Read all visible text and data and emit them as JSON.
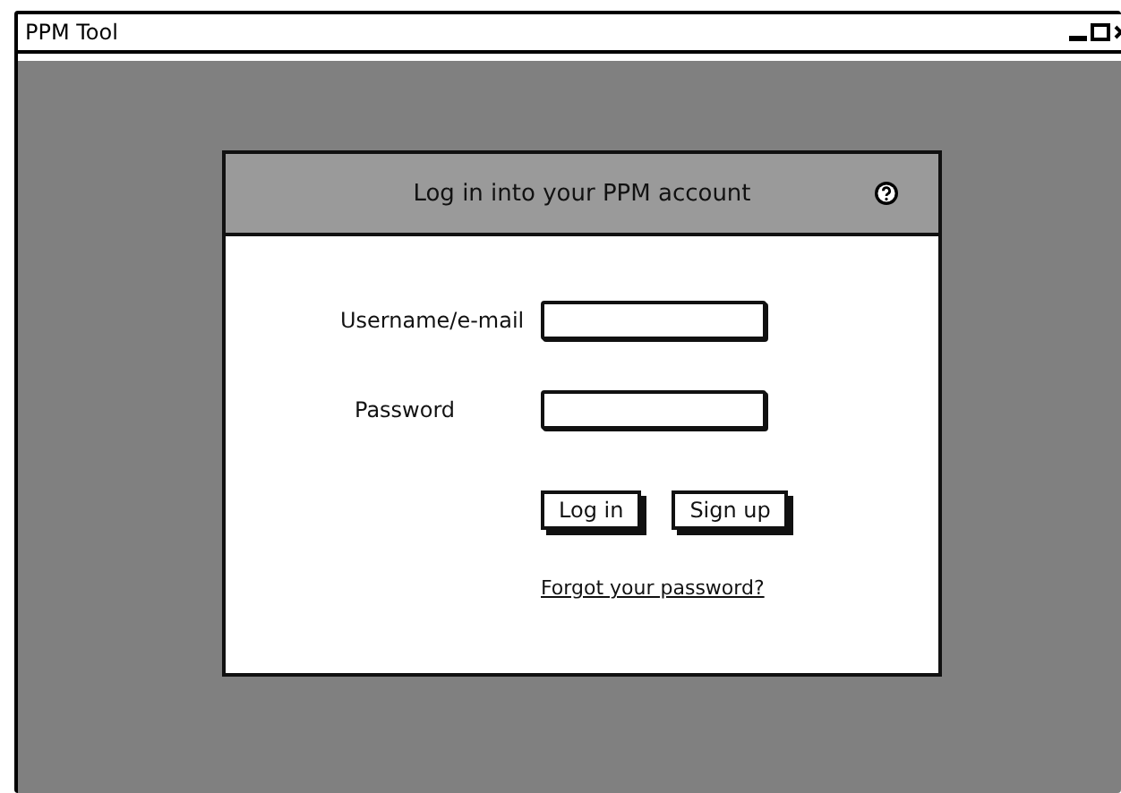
{
  "window": {
    "title": "PPM Tool"
  },
  "dialog": {
    "title": "Log in into your PPM account",
    "fields": [
      {
        "label": "Username/e-mail"
      },
      {
        "label": "Password"
      }
    ],
    "buttons": [
      "Log in",
      "Sign up"
    ],
    "link": "Forgot your password?"
  }
}
